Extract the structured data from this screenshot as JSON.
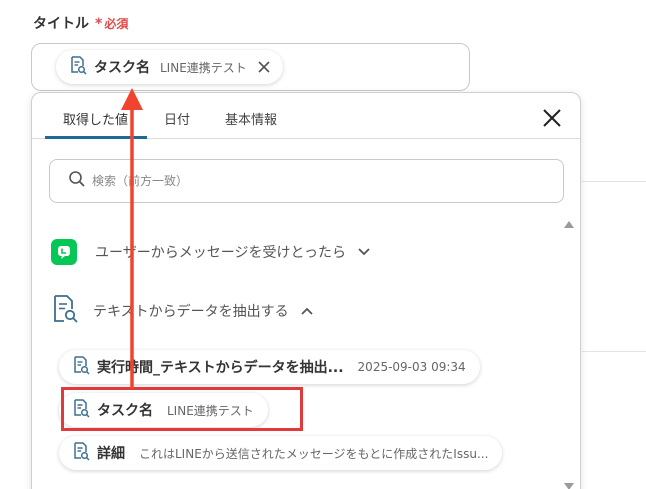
{
  "field": {
    "label": "タイトル",
    "required_mark": "*",
    "required_text": "必須"
  },
  "title_input": {
    "chip": {
      "name": "タスク名",
      "source": "LINE連携テスト"
    }
  },
  "panel": {
    "tabs": [
      {
        "label": "取得した値"
      },
      {
        "label": "日付"
      },
      {
        "label": "基本情報"
      }
    ],
    "search_placeholder": "検索（前方一致）",
    "groups": [
      {
        "label": "ユーザーからメッセージを受けとったら",
        "state": "collapsed"
      },
      {
        "label": "テキストからデータを抽出する",
        "state": "expanded"
      }
    ],
    "items": [
      {
        "name": "実行時間_テキストからデータを抽出...",
        "value": "2025-09-03 09:34"
      },
      {
        "name": "タスク名",
        "value": "LINE連携テスト"
      },
      {
        "name": "詳細",
        "value": "これはLINEから送信されたメッセージをもとに作成されたIssu..."
      }
    ]
  },
  "colors": {
    "accent": "#1d6a96",
    "required": "#e24a4a",
    "highlight": "#e03a3a",
    "line_green": "#06c755"
  }
}
